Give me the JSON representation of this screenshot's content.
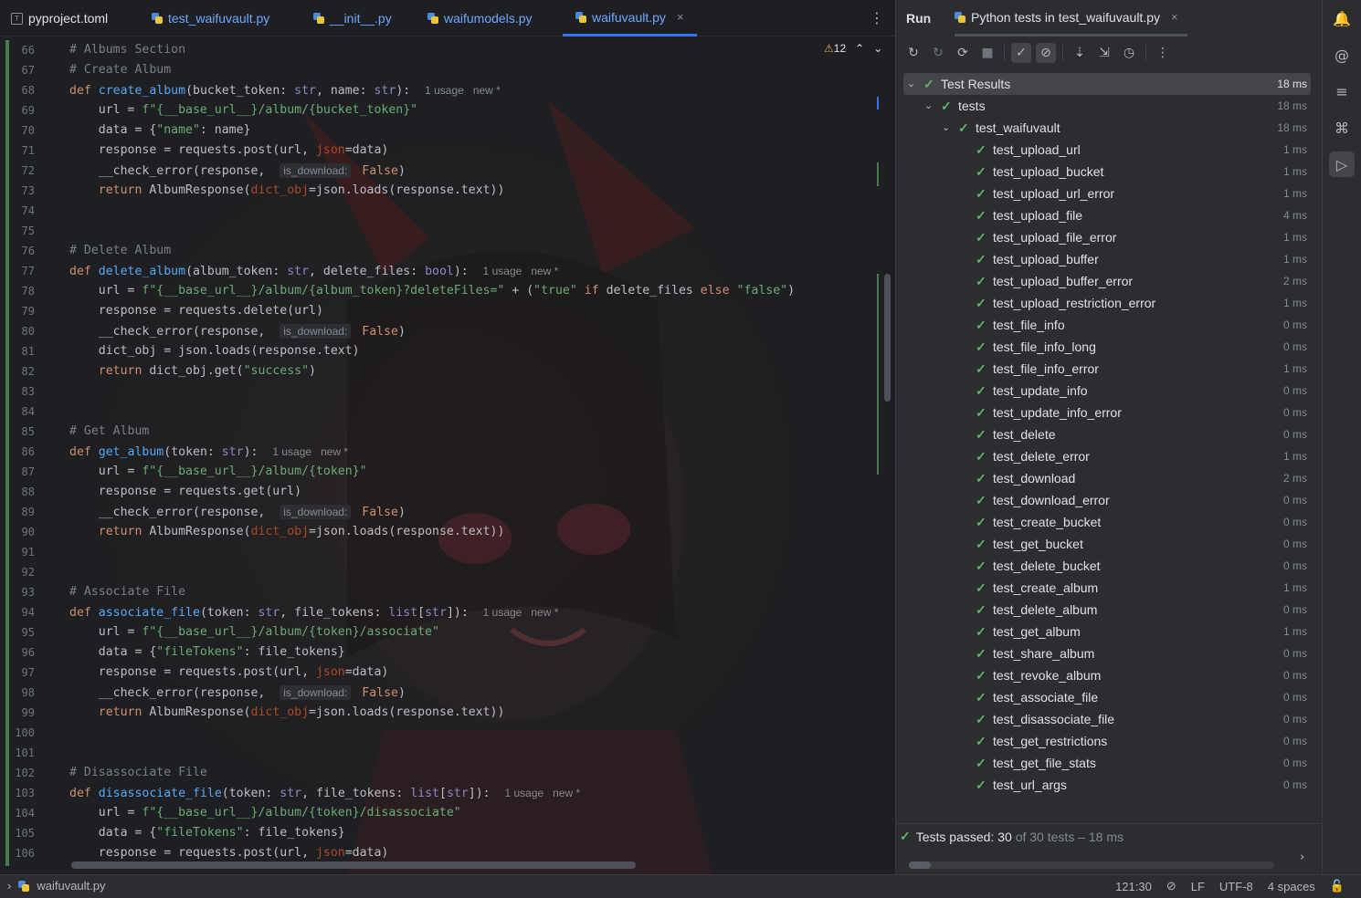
{
  "editor": {
    "tabs": [
      {
        "label": "pyproject.toml",
        "icon": "toml-file-icon",
        "active": false
      },
      {
        "label": "test_waifuvault.py",
        "icon": "python-file-icon",
        "active": false
      },
      {
        "label": "__init__.py",
        "icon": "python-file-icon",
        "active": false
      },
      {
        "label": "waifumodels.py",
        "icon": "python-file-icon",
        "active": false
      },
      {
        "label": "waifuvault.py",
        "icon": "python-file-icon",
        "active": true,
        "close": "×"
      }
    ],
    "more": "⋮",
    "warnings": {
      "count": "12",
      "up": "⌃",
      "down": "⌄"
    },
    "lines": [
      {
        "n": "66",
        "text": "# Albums Section"
      },
      {
        "n": "67",
        "text": "# Create Album"
      },
      {
        "n": "68",
        "text": "def create_album(bucket_token: str, name: str):",
        "hint": "1 usage   new *"
      },
      {
        "n": "69",
        "text": "    url = f\"{__base_url__}/album/{bucket_token}\""
      },
      {
        "n": "70",
        "text": "    data = {\"name\": name}"
      },
      {
        "n": "71",
        "text": "    response = requests.post(url, json=data)"
      },
      {
        "n": "72",
        "text": "    __check_error(response,  is_download: False)"
      },
      {
        "n": "73",
        "text": "    return AlbumResponse(dict_obj=json.loads(response.text))"
      },
      {
        "n": "74",
        "text": ""
      },
      {
        "n": "75",
        "text": ""
      },
      {
        "n": "76",
        "text": "# Delete Album"
      },
      {
        "n": "77",
        "text": "def delete_album(album_token: str, delete_files: bool):",
        "hint": "1 usage   new *"
      },
      {
        "n": "78",
        "text": "    url = f\"{__base_url__}/album/{album_token}?deleteFiles=\" + (\"true\" if delete_files else \"false\")"
      },
      {
        "n": "79",
        "text": "    response = requests.delete(url)"
      },
      {
        "n": "80",
        "text": "    __check_error(response,  is_download: False)"
      },
      {
        "n": "81",
        "text": "    dict_obj = json.loads(response.text)"
      },
      {
        "n": "82",
        "text": "    return dict_obj.get(\"success\")"
      },
      {
        "n": "83",
        "text": ""
      },
      {
        "n": "84",
        "text": ""
      },
      {
        "n": "85",
        "text": "# Get Album"
      },
      {
        "n": "86",
        "text": "def get_album(token: str):",
        "hint": "1 usage   new *"
      },
      {
        "n": "87",
        "text": "    url = f\"{__base_url__}/album/{token}\""
      },
      {
        "n": "88",
        "text": "    response = requests.get(url)"
      },
      {
        "n": "89",
        "text": "    __check_error(response,  is_download: False)"
      },
      {
        "n": "90",
        "text": "    return AlbumResponse(dict_obj=json.loads(response.text))"
      },
      {
        "n": "91",
        "text": ""
      },
      {
        "n": "92",
        "text": ""
      },
      {
        "n": "93",
        "text": "# Associate File"
      },
      {
        "n": "94",
        "text": "def associate_file(token: str, file_tokens: list[str]):",
        "hint": "1 usage   new *"
      },
      {
        "n": "95",
        "text": "    url = f\"{__base_url__}/album/{token}/associate\""
      },
      {
        "n": "96",
        "text": "    data = {\"fileTokens\": file_tokens}"
      },
      {
        "n": "97",
        "text": "    response = requests.post(url, json=data)"
      },
      {
        "n": "98",
        "text": "    __check_error(response,  is_download: False)"
      },
      {
        "n": "99",
        "text": "    return AlbumResponse(dict_obj=json.loads(response.text))"
      },
      {
        "n": "100",
        "text": ""
      },
      {
        "n": "101",
        "text": ""
      },
      {
        "n": "102",
        "text": "# Disassociate File"
      },
      {
        "n": "103",
        "text": "def disassociate_file(token: str, file_tokens: list[str]):",
        "hint": "1 usage   new *"
      },
      {
        "n": "104",
        "text": "    url = f\"{__base_url__}/album/{token}/disassociate\""
      },
      {
        "n": "105",
        "text": "    data = {\"fileTokens\": file_tokens}"
      },
      {
        "n": "106",
        "text": "    response = requests.post(url, json=data)"
      }
    ]
  },
  "run_panel": {
    "title": "Run",
    "tab": {
      "label": "Python tests in test_waifuvault.py",
      "close": "×"
    },
    "toolbar": [
      {
        "name": "rerun-icon",
        "glyph": "↻"
      },
      {
        "name": "rerun-failed-icon",
        "glyph": "↻"
      },
      {
        "name": "toggle-auto-test-icon",
        "glyph": "⟳"
      },
      {
        "name": "stop-icon",
        "glyph": "■"
      },
      {
        "name": "show-passed-icon",
        "glyph": "✓"
      },
      {
        "name": "show-ignored-icon",
        "glyph": "⊘"
      },
      {
        "name": "sort-alphabetically-icon",
        "glyph": "⇣"
      },
      {
        "name": "sort-by-duration-icon",
        "glyph": "⇲"
      },
      {
        "name": "history-icon",
        "glyph": "◷"
      },
      {
        "name": "more-icon",
        "glyph": "⋮"
      }
    ],
    "tree": {
      "root": {
        "label": "Test Results",
        "time": "18 ms"
      },
      "folder": {
        "label": "tests",
        "time": "18 ms"
      },
      "module": {
        "label": "test_waifuvault",
        "time": "18 ms"
      },
      "tests": [
        {
          "label": "test_upload_url",
          "time": "1 ms"
        },
        {
          "label": "test_upload_bucket",
          "time": "1 ms"
        },
        {
          "label": "test_upload_url_error",
          "time": "1 ms"
        },
        {
          "label": "test_upload_file",
          "time": "4 ms"
        },
        {
          "label": "test_upload_file_error",
          "time": "1 ms"
        },
        {
          "label": "test_upload_buffer",
          "time": "1 ms"
        },
        {
          "label": "test_upload_buffer_error",
          "time": "2 ms"
        },
        {
          "label": "test_upload_restriction_error",
          "time": "1 ms"
        },
        {
          "label": "test_file_info",
          "time": "0 ms"
        },
        {
          "label": "test_file_info_long",
          "time": "0 ms"
        },
        {
          "label": "test_file_info_error",
          "time": "1 ms"
        },
        {
          "label": "test_update_info",
          "time": "0 ms"
        },
        {
          "label": "test_update_info_error",
          "time": "0 ms"
        },
        {
          "label": "test_delete",
          "time": "0 ms"
        },
        {
          "label": "test_delete_error",
          "time": "1 ms"
        },
        {
          "label": "test_download",
          "time": "2 ms"
        },
        {
          "label": "test_download_error",
          "time": "0 ms"
        },
        {
          "label": "test_create_bucket",
          "time": "0 ms"
        },
        {
          "label": "test_get_bucket",
          "time": "0 ms"
        },
        {
          "label": "test_delete_bucket",
          "time": "0 ms"
        },
        {
          "label": "test_create_album",
          "time": "1 ms"
        },
        {
          "label": "test_delete_album",
          "time": "0 ms"
        },
        {
          "label": "test_get_album",
          "time": "1 ms"
        },
        {
          "label": "test_share_album",
          "time": "0 ms"
        },
        {
          "label": "test_revoke_album",
          "time": "0 ms"
        },
        {
          "label": "test_associate_file",
          "time": "0 ms"
        },
        {
          "label": "test_disassociate_file",
          "time": "0 ms"
        },
        {
          "label": "test_get_restrictions",
          "time": "0 ms"
        },
        {
          "label": "test_get_file_stats",
          "time": "0 ms"
        },
        {
          "label": "test_url_args",
          "time": "0 ms"
        }
      ]
    },
    "status": {
      "prefix": "Tests passed: ",
      "passed": "30",
      "suffix": " of 30 tests – 18 ms"
    }
  },
  "right_strip": [
    {
      "name": "notifications-icon",
      "glyph": "🔔"
    },
    {
      "name": "ai-assistant-icon",
      "glyph": "@"
    },
    {
      "name": "database-icon",
      "glyph": "≡"
    },
    {
      "name": "python-console-icon",
      "glyph": "⌘"
    },
    {
      "name": "run-icon",
      "glyph": "▷"
    }
  ],
  "statusbar": {
    "breadcrumb": "waifuvault.py",
    "position": "121:30",
    "line_ending": "LF",
    "encoding": "UTF-8",
    "indent": "4 spaces"
  },
  "colors": {
    "accent": "#3574f0",
    "pass": "#5fb865",
    "bg": "#1e1f22",
    "panel": "#2b2d30"
  }
}
